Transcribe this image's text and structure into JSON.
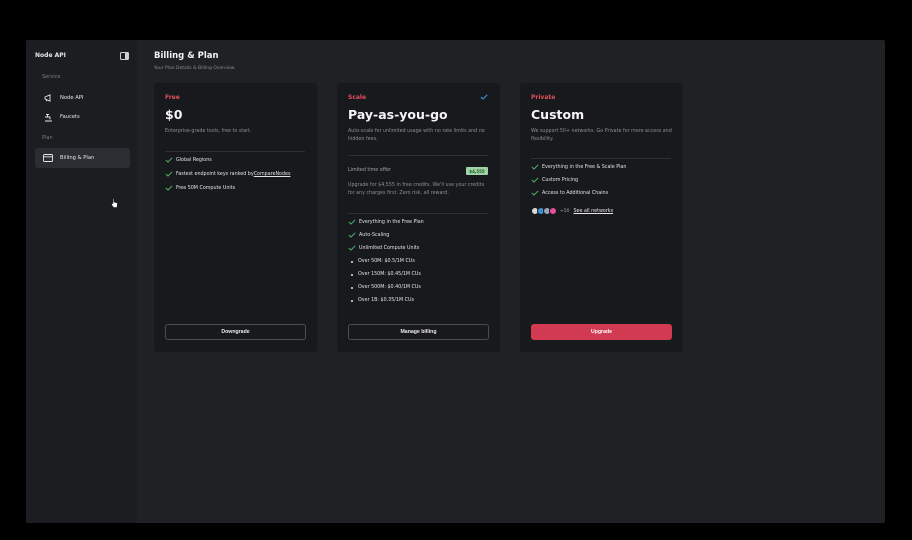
{
  "sidebar": {
    "title": "Node API",
    "sections": [
      {
        "label": "Service",
        "items": [
          {
            "label": "Node API",
            "icon": "megaphone-icon"
          },
          {
            "label": "Faucets",
            "icon": "faucet-icon"
          }
        ]
      },
      {
        "label": "Plan",
        "items": [
          {
            "label": "Billing & Plan",
            "icon": "card-icon",
            "active": true
          }
        ]
      }
    ]
  },
  "header": {
    "title": "Billing & Plan",
    "subtitle": "Your Plan Details & Billing Overview."
  },
  "plans": [
    {
      "tier": "Free",
      "tier_color": "#e24f5f",
      "price": "$0",
      "description": "Enterprise-grade tools, free to start.",
      "features": [
        "Global Regions",
        "Fastest endpoint keys ranked by ",
        "Free 50M Compute Units"
      ],
      "feature_link": "CompareNodes",
      "button": "Downgrade"
    },
    {
      "tier": "Scale",
      "tier_color": "#e24f5f",
      "price": "Pay-as-you-go",
      "description": "Auto-scale for unlimited usage with no rate limits and no hidden fees.",
      "offer_label": "Limited time offer",
      "offer_badge": "$4,555",
      "offer_text": "Upgrade for $4,555 in free credits. We'll use your credits for any charges first. Zero risk, all reward.",
      "features": [
        "Everything in the Free Plan",
        "Auto-Scaling",
        "Unlimited Compute Units"
      ],
      "tiers": [
        "Over 50M: $0.5/1M CUs",
        "Over 150M: $0.45/1M CUs",
        "Over 500M: $0.40/1M CUs",
        "Over 1B: $0.35/1M CUs"
      ],
      "button": "Manage billing",
      "selected": true
    },
    {
      "tier": "Private",
      "tier_color": "#e24f5f",
      "price": "Custom",
      "description": "We support 50+ networks. Go Private for more access and flexibility.",
      "features": [
        "Everything in the Free & Scale Plan",
        "Custom Pricing",
        "Access to Additional Chains"
      ],
      "networks_more": "+50",
      "networks_link": "See all networks",
      "button": "Upgrade"
    }
  ],
  "colors": {
    "accent": "#d13a50",
    "check": "#4caf6a",
    "card_bg": "#18191c",
    "app_bg": "#1f2124"
  }
}
